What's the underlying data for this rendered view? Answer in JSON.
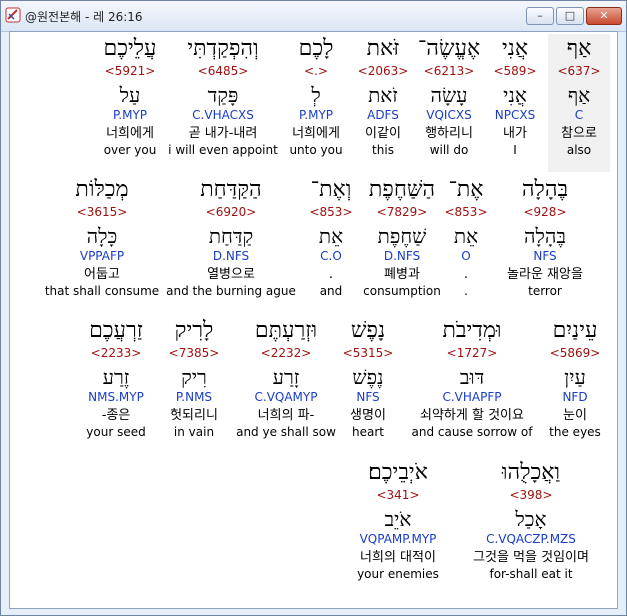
{
  "window": {
    "title": "@원전본해 - 레 26:16",
    "minimize_label": "–",
    "maximize_label": "□",
    "close_label": "✕"
  },
  "words": [
    {
      "heb": "אַף",
      "strong": "<637>",
      "lex": "אַף",
      "morph": "C",
      "kor": "참으로",
      "eng": "also"
    },
    {
      "heb": "אֲנִי",
      "strong": "<589>",
      "lex": "אֲנִי",
      "morph": "NPCXS",
      "kor": "내가",
      "eng": "I"
    },
    {
      "heb": "אֶעֱשֶׂה־",
      "strong": "<6213>",
      "lex": "עָשָׂה",
      "morph": "VQICXS",
      "kor": "행하리니",
      "eng": "will do"
    },
    {
      "heb": "זֹּאת",
      "strong": "<2063>",
      "lex": "זֹאת",
      "morph": "ADFS",
      "kor": "이같이",
      "eng": "this"
    },
    {
      "heb": "לָכֶם",
      "strong": "<.>",
      "lex": "לְ",
      "morph": "P.MYP",
      "kor": "너희에게",
      "eng": "unto you"
    },
    {
      "heb": "וְהִפְקַדְתִּי",
      "strong": "<6485>",
      "lex": "פָּקַד",
      "morph": "C.VHACXS",
      "kor": "곧 내가-내려",
      "eng": "i will even appoint"
    },
    {
      "heb": "עֲלֵיכֶם",
      "strong": "<5921>",
      "lex": "עַל",
      "morph": "P.MYP",
      "kor": "너희에게",
      "eng": "over you"
    },
    {
      "heb": "בֶּהָלָה",
      "strong": "<928>",
      "lex": "בֶּהָלָה",
      "morph": "NFS",
      "kor": "놀라운 재앙을",
      "eng": "terror"
    },
    {
      "heb": "אֶת־",
      "strong": "<853>",
      "lex": "אֵת",
      "morph": "O",
      "kor": ".",
      "eng": "."
    },
    {
      "heb": "הַשַּׁחֶפֶת",
      "strong": "<7829>",
      "lex": "שַׁחֶפֶת",
      "morph": "D.NFS",
      "kor": "폐병과",
      "eng": "consumption"
    },
    {
      "heb": "וְאֶת־",
      "strong": "<853>",
      "lex": "אֵת",
      "morph": "C.O",
      "kor": ".",
      "eng": "and"
    },
    {
      "heb": "הַקַּדַּחַת",
      "strong": "<6920>",
      "lex": "קַדַּחַת",
      "morph": "D.NFS",
      "kor": "열병으로",
      "eng": "and the burning ague"
    },
    {
      "heb": "מְכַלּוֹת",
      "strong": "<3615>",
      "lex": "כָּלָה",
      "morph": "VPPAFP",
      "kor": "어둡고",
      "eng": "that shall consume"
    },
    {
      "heb": "עֵינַיִם",
      "strong": "<5869>",
      "lex": "עַיִן",
      "morph": "NFD",
      "kor": "눈이",
      "eng": "the eyes"
    },
    {
      "heb": "וּמְדִיבֹת",
      "strong": "<1727>",
      "lex": "דּוּב",
      "morph": "C.VHAPFP",
      "kor": "쇠약하게 할 것이요",
      "eng": "and cause sorrow of"
    },
    {
      "heb": "נָפֶשׁ",
      "strong": "<5315>",
      "lex": "נֶפֶשׁ",
      "morph": "NFS",
      "kor": "생명이",
      "eng": "heart"
    },
    {
      "heb": "וּזְרַעְתֶּם",
      "strong": "<2232>",
      "lex": "זָרַע",
      "morph": "C.VQAMYP",
      "kor": "너희의 파-",
      "eng": "and ye shall sow"
    },
    {
      "heb": "לָרִיק",
      "strong": "<7385>",
      "lex": "רִיק",
      "morph": "P.NMS",
      "kor": "헛되리니",
      "eng": "in vain"
    },
    {
      "heb": "זַרְעֲכֶם",
      "strong": "<2233>",
      "lex": "זֶרַע",
      "morph": "NMS.MYP",
      "kor": "-종은",
      "eng": "your seed"
    },
    {
      "heb": "וַאֲכָלֻהוּ",
      "strong": "<398>",
      "lex": "אָכַל",
      "morph": "C.VQACZP.MZS",
      "kor": "그것을 먹을 것임이며",
      "eng": "for-shall eat it"
    },
    {
      "heb": "אֹיְבֵיכֶם׃",
      "strong": "<341>",
      "lex": "אֹיֵב",
      "morph": "VQPAMP.MYP",
      "kor": "너희의 대적이",
      "eng": "your enemies"
    }
  ]
}
